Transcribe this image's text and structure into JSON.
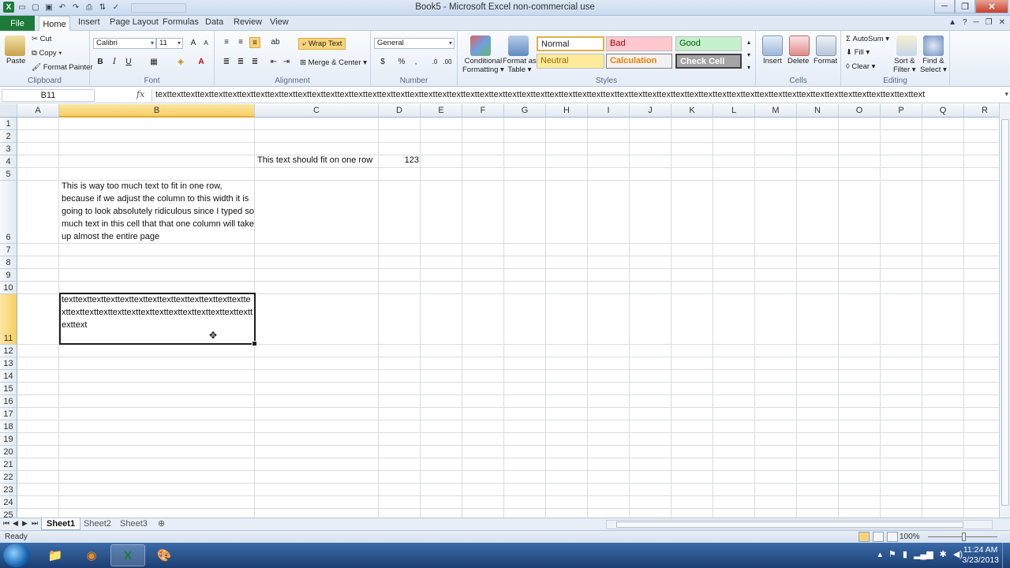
{
  "window": {
    "title": "Book5 - Microsoft Excel non-commercial use",
    "controls": [
      "minimize",
      "restore",
      "close"
    ]
  },
  "ribbon_tabs": [
    "File",
    "Home",
    "Insert",
    "Page Layout",
    "Formulas",
    "Data",
    "Review",
    "View"
  ],
  "ribbon": {
    "clipboard": {
      "paste": "Paste",
      "cut": "Cut",
      "copy": "Copy",
      "format_painter": "Format Painter",
      "label": "Clipboard"
    },
    "font": {
      "name": "Calibri",
      "size": "11",
      "bold": "B",
      "italic": "I",
      "underline": "U",
      "label": "Font"
    },
    "alignment": {
      "wrap_text": "Wrap Text",
      "merge_center": "Merge & Center",
      "label": "Alignment"
    },
    "number": {
      "format": "General",
      "currency": "$",
      "percent": "%",
      "comma": ",",
      "label": "Number"
    },
    "styles": {
      "conditional": [
        "Conditional",
        "Formatting"
      ],
      "format_table": [
        "Format as",
        "Table"
      ],
      "normal": "Normal",
      "bad": "Bad",
      "good": "Good",
      "neutral": "Neutral",
      "calculation": "Calculation",
      "check_cell": "Check Cell",
      "label": "Styles"
    },
    "cells": {
      "insert": "Insert",
      "delete": "Delete",
      "format": "Format",
      "label": "Cells"
    },
    "editing": {
      "autosum": "AutoSum",
      "fill": "Fill",
      "clear": "Clear",
      "sort": [
        "Sort &",
        "Filter"
      ],
      "find": [
        "Find &",
        "Select"
      ],
      "label": "Editing"
    }
  },
  "formula_bar": {
    "name_box": "B11",
    "fx": "fx",
    "content": "texttexttexttexttexttexttexttexttexttexttexttexttexttexttexttexttexttexttexttexttexttexttexttexttexttexttexttexttexttexttexttexttexttexttexttexttexttexttexttexttexttexttexttexttexttexttexttexttexttexttexttexttexttexttext"
  },
  "columns": [
    "A",
    "B",
    "C",
    "D",
    "E",
    "F",
    "G",
    "H",
    "I",
    "J",
    "K",
    "L",
    "M",
    "N",
    "O",
    "P",
    "Q",
    "R"
  ],
  "rows": [
    "1",
    "2",
    "3",
    "4",
    "5",
    "6",
    "7",
    "8",
    "9",
    "10",
    "11",
    "12",
    "13",
    "14",
    "15",
    "16",
    "17",
    "18",
    "19",
    "20",
    "21",
    "22",
    "23",
    "24",
    "25"
  ],
  "cells": {
    "C4": "This text should fit on one row",
    "D4": "123",
    "B6": "This is way too much text to fit in one row, because if we adjust the column to this width it is going to look absolutely ridiculous since I typed so much text in this cell that that one column will take up almost the entire page",
    "B11": "texttexttexttexttexttexttexttexttexttexttexttexttexttexttexttexttexttexttexttexttexttexttexttexttexttexttexttexttext"
  },
  "sheets": [
    "Sheet1",
    "Sheet2",
    "Sheet3"
  ],
  "active_sheet": "Sheet1",
  "status": {
    "ready": "Ready",
    "zoom": "100%"
  },
  "taskbar": {
    "apps": [
      "windows-explorer",
      "firefox",
      "excel",
      "paint"
    ],
    "time": "11:24 AM",
    "date": "3/23/2013"
  }
}
